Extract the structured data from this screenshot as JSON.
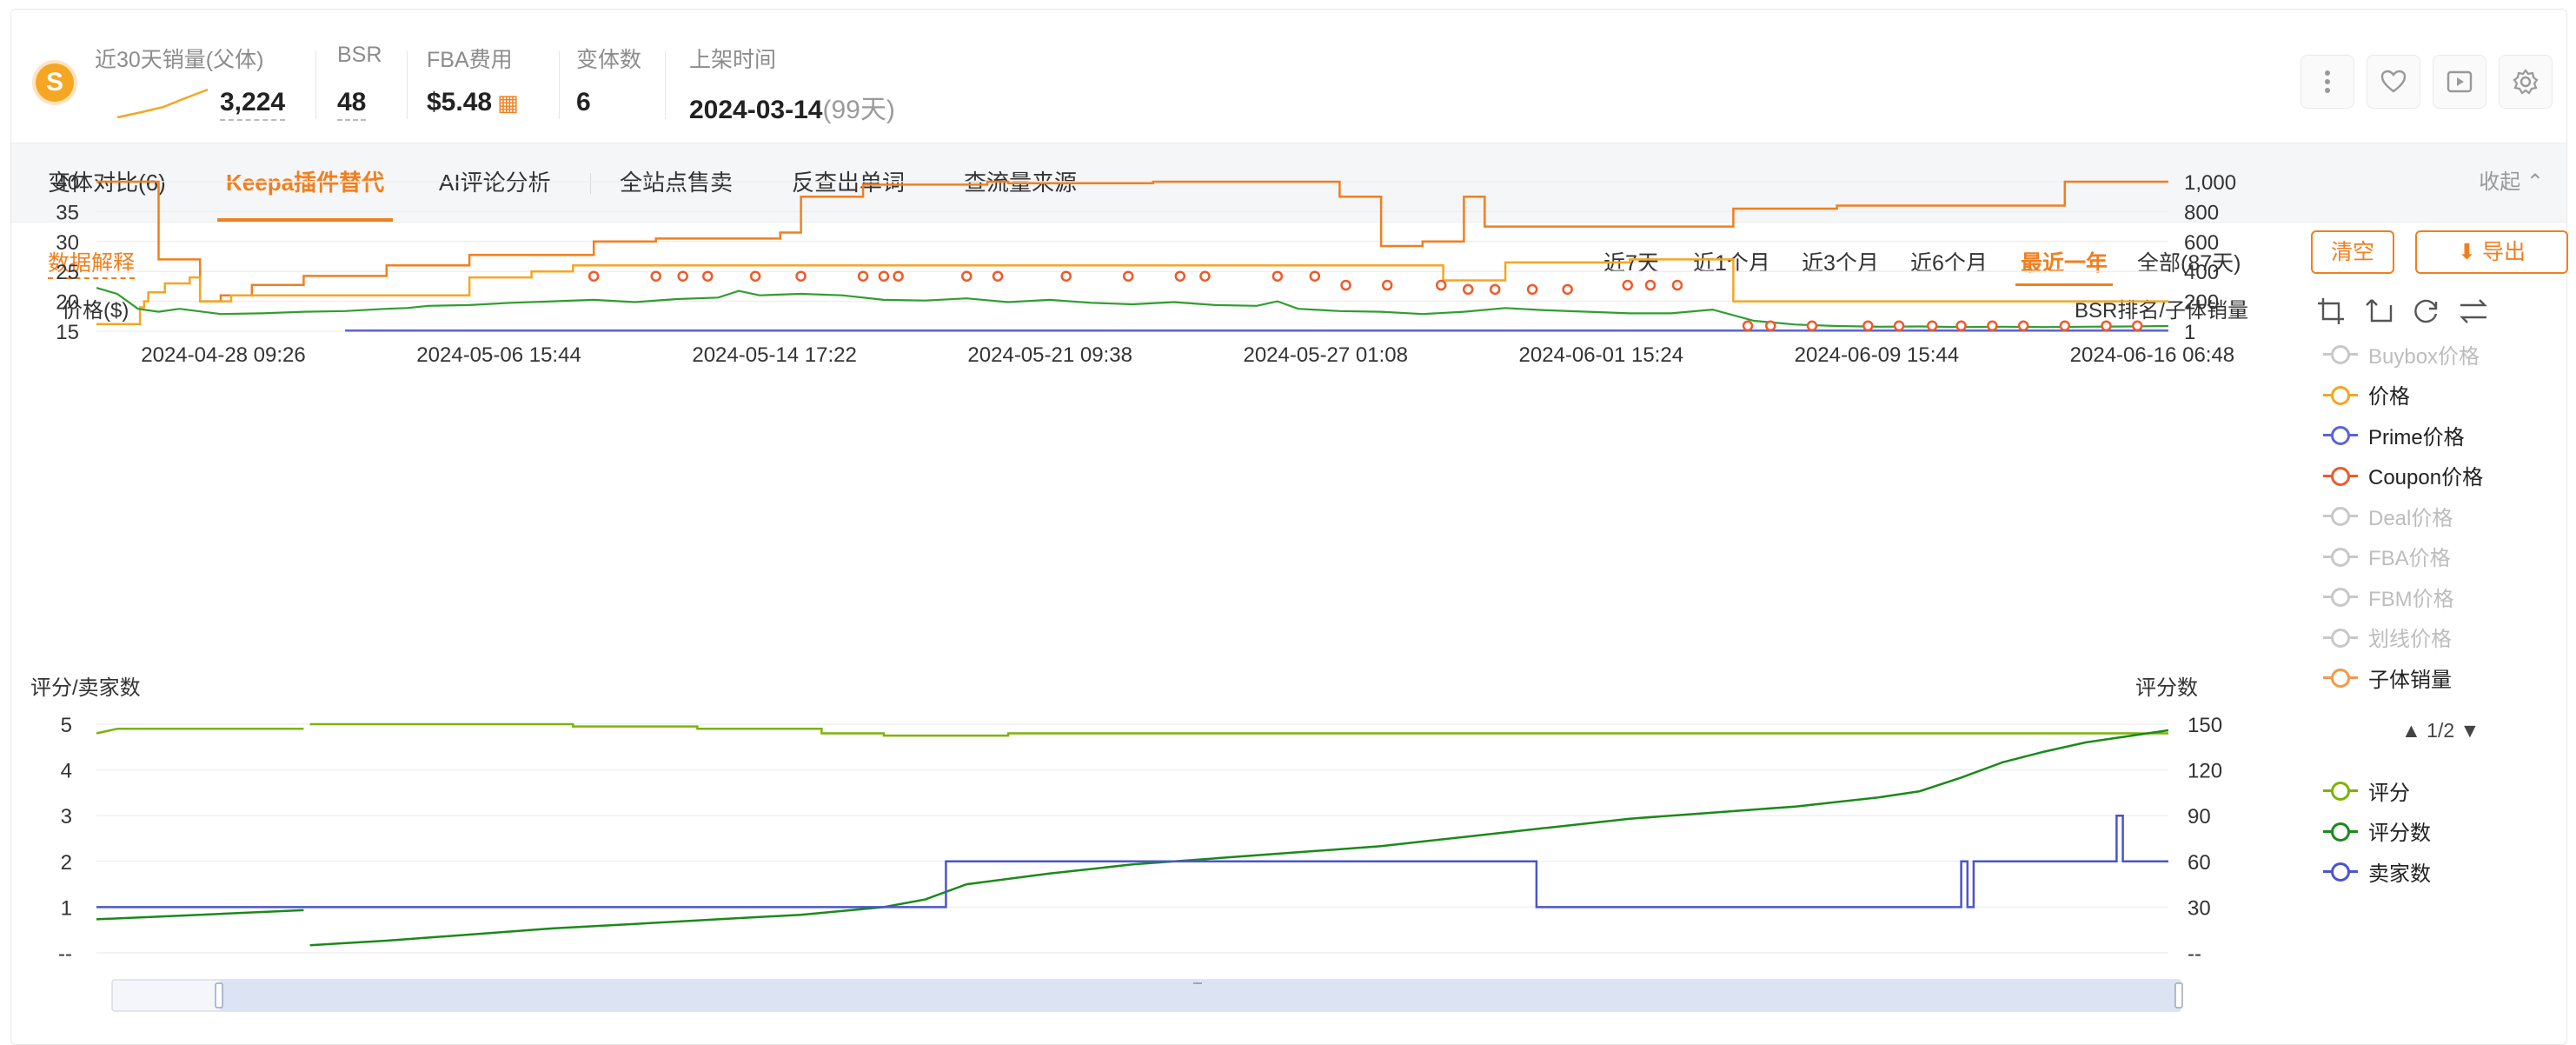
{
  "header": {
    "metrics": [
      {
        "label": "近30天销量(父体)",
        "value": "3,224"
      },
      {
        "label": "BSR",
        "value": "48"
      },
      {
        "label": "FBA费用",
        "value": "$5.48"
      },
      {
        "label": "变体数",
        "value": "6"
      },
      {
        "label": "上架时间",
        "value": "2024-03-14",
        "extra": "(99天)"
      }
    ],
    "icons": [
      "more-icon",
      "heart-icon",
      "video-icon",
      "gear-icon"
    ]
  },
  "tabs": [
    "变体对比(6)",
    "Keepa插件替代",
    "AI评论分析",
    "全站点售卖",
    "反查出单词",
    "查流量来源"
  ],
  "active_tab": 1,
  "collapse_label": "收起",
  "explain_label": "数据解释",
  "ranges": [
    "近7天",
    "近1个月",
    "近3个月",
    "近6个月",
    "最近一年",
    "全部(87天)"
  ],
  "active_range": 4,
  "buttons": {
    "clear": "清空",
    "export": "导出"
  },
  "legend": {
    "top": [
      {
        "name": "Buybox价格",
        "color": "#c8c8c8",
        "on": false
      },
      {
        "name": "价格",
        "color": "#f5a623",
        "on": true
      },
      {
        "name": "Prime价格",
        "color": "#5b63d6",
        "on": true
      },
      {
        "name": "Coupon价格",
        "color": "#ef5a28",
        "on": true
      },
      {
        "name": "Deal价格",
        "color": "#c8c8c8",
        "on": false
      },
      {
        "name": "FBA价格",
        "color": "#c8c8c8",
        "on": false
      },
      {
        "name": "FBM价格",
        "color": "#c8c8c8",
        "on": false
      },
      {
        "name": "划线价格",
        "color": "#c8c8c8",
        "on": false
      },
      {
        "name": "子体销量",
        "color": "#f29a4a",
        "on": true
      }
    ],
    "pager": "▲ 1/2 ▼",
    "bottom": [
      {
        "name": "评分",
        "color": "#7cb305",
        "on": true
      },
      {
        "name": "评分数",
        "color": "#1a8a1a",
        "on": true
      },
      {
        "name": "卖家数",
        "color": "#4b55c9",
        "on": true
      }
    ]
  },
  "chart_data": [
    {
      "type": "line",
      "ylabel_left": "价格($)",
      "ylabel_right": "BSR排名/子体销量",
      "ylim_left": [
        15,
        40
      ],
      "yticks_left": [
        15,
        20,
        25,
        30,
        35,
        40
      ],
      "ylim_right": [
        0,
        1000
      ],
      "yticks_right": [
        "1",
        "200",
        "400",
        "600",
        "800",
        "1,000"
      ],
      "yticks_right_values": [
        0,
        200,
        400,
        600,
        800,
        1000
      ],
      "xticks": [
        "2024-04-28 09:26",
        "2024-05-06 15:44",
        "2024-05-14 17:22",
        "2024-05-21 09:38",
        "2024-05-27 01:08",
        "2024-06-01 15:24",
        "2024-06-09 15:44",
        "2024-06-16 06:48"
      ],
      "x_range": [
        0,
        100
      ],
      "series": [
        {
          "name": "价格",
          "axis": "left",
          "color": "#f5a623",
          "points": [
            [
              0,
              16.2
            ],
            [
              2.1,
              16.2
            ],
            [
              2.1,
              19
            ],
            [
              2.3,
              19
            ],
            [
              2.3,
              20
            ],
            [
              2.5,
              20
            ],
            [
              2.5,
              21.5
            ],
            [
              3.3,
              21.5
            ],
            [
              3.3,
              23
            ],
            [
              4.5,
              23
            ],
            [
              4.5,
              24
            ],
            [
              5,
              24
            ],
            [
              5,
              20
            ],
            [
              6.5,
              20
            ],
            [
              6.5,
              21
            ],
            [
              18,
              21
            ],
            [
              18,
              24
            ],
            [
              21,
              24
            ],
            [
              21,
              25
            ],
            [
              23,
              25
            ],
            [
              23,
              26
            ],
            [
              65,
              26
            ],
            [
              65,
              23.5
            ],
            [
              68,
              23.5
            ],
            [
              68,
              26.5
            ],
            [
              74,
              26.5
            ],
            [
              74,
              27
            ],
            [
              79,
              27
            ],
            [
              79,
              20
            ],
            [
              100,
              20
            ]
          ]
        },
        {
          "name": "Prime价格",
          "axis": "left",
          "color": "#5b63d6",
          "points": [
            [
              12,
              15.1
            ],
            [
              100,
              15.1
            ]
          ]
        }
      ],
      "bsr": {
        "name": "BSR排名",
        "color": "#f07f1f",
        "points": [
          [
            0,
            1000
          ],
          [
            3,
            1000
          ],
          [
            3,
            480
          ],
          [
            5,
            480
          ],
          [
            5,
            200
          ],
          [
            6,
            200
          ],
          [
            6,
            240
          ],
          [
            7.5,
            240
          ],
          [
            7.5,
            310
          ],
          [
            10,
            310
          ],
          [
            10,
            370
          ],
          [
            14,
            370
          ],
          [
            14,
            440
          ],
          [
            18,
            440
          ],
          [
            18,
            510
          ],
          [
            24,
            510
          ],
          [
            24,
            600
          ],
          [
            27,
            600
          ],
          [
            27,
            620
          ],
          [
            33,
            620
          ],
          [
            33,
            660
          ],
          [
            34,
            660
          ],
          [
            34,
            900
          ],
          [
            37,
            900
          ],
          [
            37,
            980
          ],
          [
            43,
            980
          ],
          [
            43,
            1000
          ],
          [
            44,
            1000
          ],
          [
            44,
            990
          ],
          [
            51,
            990
          ],
          [
            51,
            1000
          ],
          [
            60,
            1000
          ],
          [
            60,
            900
          ],
          [
            62,
            900
          ],
          [
            62,
            570
          ],
          [
            64,
            570
          ],
          [
            64,
            600
          ],
          [
            66,
            600
          ],
          [
            66,
            900
          ],
          [
            67,
            900
          ],
          [
            67,
            700
          ],
          [
            79,
            700
          ],
          [
            79,
            820
          ],
          [
            84,
            820
          ],
          [
            84,
            840
          ],
          [
            95,
            840
          ],
          [
            95,
            1000
          ],
          [
            100,
            1000
          ]
        ]
      },
      "sales": {
        "name": "子体销量",
        "color": "#2f9e2f",
        "points": [
          [
            0,
            290
          ],
          [
            1,
            250
          ],
          [
            2,
            150
          ],
          [
            3,
            130
          ],
          [
            4,
            150
          ],
          [
            6,
            115
          ],
          [
            8,
            120
          ],
          [
            10,
            130
          ],
          [
            12,
            135
          ],
          [
            14,
            150
          ],
          [
            15,
            155
          ],
          [
            16,
            170
          ],
          [
            18,
            175
          ],
          [
            20,
            190
          ],
          [
            22,
            200
          ],
          [
            24,
            210
          ],
          [
            26,
            195
          ],
          [
            28,
            215
          ],
          [
            30,
            225
          ],
          [
            31,
            270
          ],
          [
            32,
            240
          ],
          [
            34,
            250
          ],
          [
            36,
            240
          ],
          [
            38,
            210
          ],
          [
            40,
            205
          ],
          [
            42,
            220
          ],
          [
            44,
            195
          ],
          [
            46,
            210
          ],
          [
            48,
            190
          ],
          [
            50,
            180
          ],
          [
            52,
            195
          ],
          [
            54,
            175
          ],
          [
            56,
            170
          ],
          [
            57,
            200
          ],
          [
            58,
            150
          ],
          [
            60,
            135
          ],
          [
            62,
            130
          ],
          [
            64,
            115
          ],
          [
            66,
            130
          ],
          [
            68,
            155
          ],
          [
            70,
            140
          ],
          [
            72,
            130
          ],
          [
            74,
            120
          ],
          [
            76,
            120
          ],
          [
            78,
            145
          ],
          [
            80,
            70
          ],
          [
            82,
            45
          ],
          [
            84,
            35
          ],
          [
            86,
            30
          ],
          [
            88,
            32
          ],
          [
            90,
            28
          ],
          [
            92,
            30
          ],
          [
            94,
            28
          ],
          [
            96,
            30
          ],
          [
            98,
            32
          ],
          [
            100,
            35
          ]
        ]
      },
      "coupon": {
        "name": "Coupon价格",
        "color": "#ef5a28",
        "points": [
          [
            24,
            24.2
          ],
          [
            27,
            24.2
          ],
          [
            28.3,
            24.2
          ],
          [
            29.5,
            24.2
          ],
          [
            31.8,
            24.2
          ],
          [
            34,
            24.2
          ],
          [
            37,
            24.2
          ],
          [
            38,
            24.2
          ],
          [
            38.7,
            24.2
          ],
          [
            42,
            24.2
          ],
          [
            43.5,
            24.2
          ],
          [
            46.8,
            24.2
          ],
          [
            49.8,
            24.2
          ],
          [
            52.3,
            24.2
          ],
          [
            53.5,
            24.2
          ],
          [
            57,
            24.2
          ],
          [
            58.8,
            24.2
          ],
          [
            60.3,
            22.7
          ],
          [
            62.3,
            22.7
          ],
          [
            64.9,
            22.7
          ],
          [
            66.2,
            22
          ],
          [
            67.5,
            22
          ],
          [
            69.3,
            22
          ],
          [
            71,
            22
          ],
          [
            73.9,
            22.7
          ],
          [
            75,
            22.7
          ],
          [
            76.3,
            22.7
          ],
          [
            79.7,
            15.9
          ],
          [
            80.8,
            15.9
          ],
          [
            82.8,
            15.9
          ],
          [
            85.5,
            15.9
          ],
          [
            87,
            15.9
          ],
          [
            88.6,
            15.9
          ],
          [
            90,
            15.9
          ],
          [
            91.5,
            15.9
          ],
          [
            93,
            15.9
          ],
          [
            95,
            15.9
          ],
          [
            97,
            15.9
          ],
          [
            98.5,
            15.9
          ]
        ]
      }
    },
    {
      "type": "line",
      "ylabel_left": "评分/卖家数",
      "ylabel_right": "评分数",
      "ylim_left": [
        0,
        5
      ],
      "yticks_left": [
        "--",
        "1",
        "2",
        "3",
        "4",
        "5"
      ],
      "ylim_right": [
        0,
        150
      ],
      "yticks_right": [
        "--",
        "30",
        "60",
        "90",
        "120",
        "150"
      ],
      "x_range": [
        0,
        100
      ],
      "series": [
        {
          "name": "评分",
          "axis": "left",
          "color": "#7cb305",
          "points": [
            [
              0,
              4.8
            ],
            [
              1,
              4.9
            ],
            [
              10,
              4.9
            ],
            [
              10,
              null
            ],
            [
              10.3,
              5.0
            ],
            [
              23,
              5.0
            ],
            [
              23,
              4.95
            ],
            [
              29,
              4.95
            ],
            [
              29,
              4.9
            ],
            [
              35,
              4.9
            ],
            [
              35,
              4.8
            ],
            [
              38,
              4.8
            ],
            [
              38,
              4.75
            ],
            [
              44,
              4.75
            ],
            [
              44,
              4.8
            ],
            [
              60,
              4.8
            ],
            [
              60,
              4.8
            ],
            [
              100,
              4.8
            ]
          ]
        },
        {
          "name": "评分数",
          "axis": "right",
          "color": "#1a8a1a",
          "points": [
            [
              0,
              22
            ],
            [
              5,
              25
            ],
            [
              10,
              28
            ],
            [
              10,
              null
            ],
            [
              10.3,
              5
            ],
            [
              14,
              8
            ],
            [
              18,
              12
            ],
            [
              22,
              16
            ],
            [
              26,
              19
            ],
            [
              30,
              22
            ],
            [
              34,
              25
            ],
            [
              38,
              30
            ],
            [
              40,
              35
            ],
            [
              42,
              45
            ],
            [
              46,
              52
            ],
            [
              50,
              58
            ],
            [
              54,
              62
            ],
            [
              58,
              66
            ],
            [
              62,
              70
            ],
            [
              66,
              76
            ],
            [
              70,
              82
            ],
            [
              74,
              88
            ],
            [
              78,
              92
            ],
            [
              82,
              96
            ],
            [
              86,
              102
            ],
            [
              88,
              106
            ],
            [
              90,
              115
            ],
            [
              92,
              125
            ],
            [
              94,
              132
            ],
            [
              96,
              138
            ],
            [
              98,
              142
            ],
            [
              100,
              146
            ]
          ]
        },
        {
          "name": "卖家数",
          "axis": "left",
          "color": "#4b55c9",
          "points": [
            [
              0,
              1
            ],
            [
              41,
              1
            ],
            [
              41,
              2
            ],
            [
              69.5,
              2
            ],
            [
              69.5,
              1
            ],
            [
              90,
              1
            ],
            [
              90,
              2
            ],
            [
              90.3,
              2
            ],
            [
              90.3,
              1
            ],
            [
              90.6,
              1
            ],
            [
              90.6,
              2
            ],
            [
              97.5,
              2
            ],
            [
              97.5,
              3
            ],
            [
              97.8,
              3
            ],
            [
              97.8,
              2
            ],
            [
              100,
              2
            ]
          ]
        }
      ]
    }
  ]
}
